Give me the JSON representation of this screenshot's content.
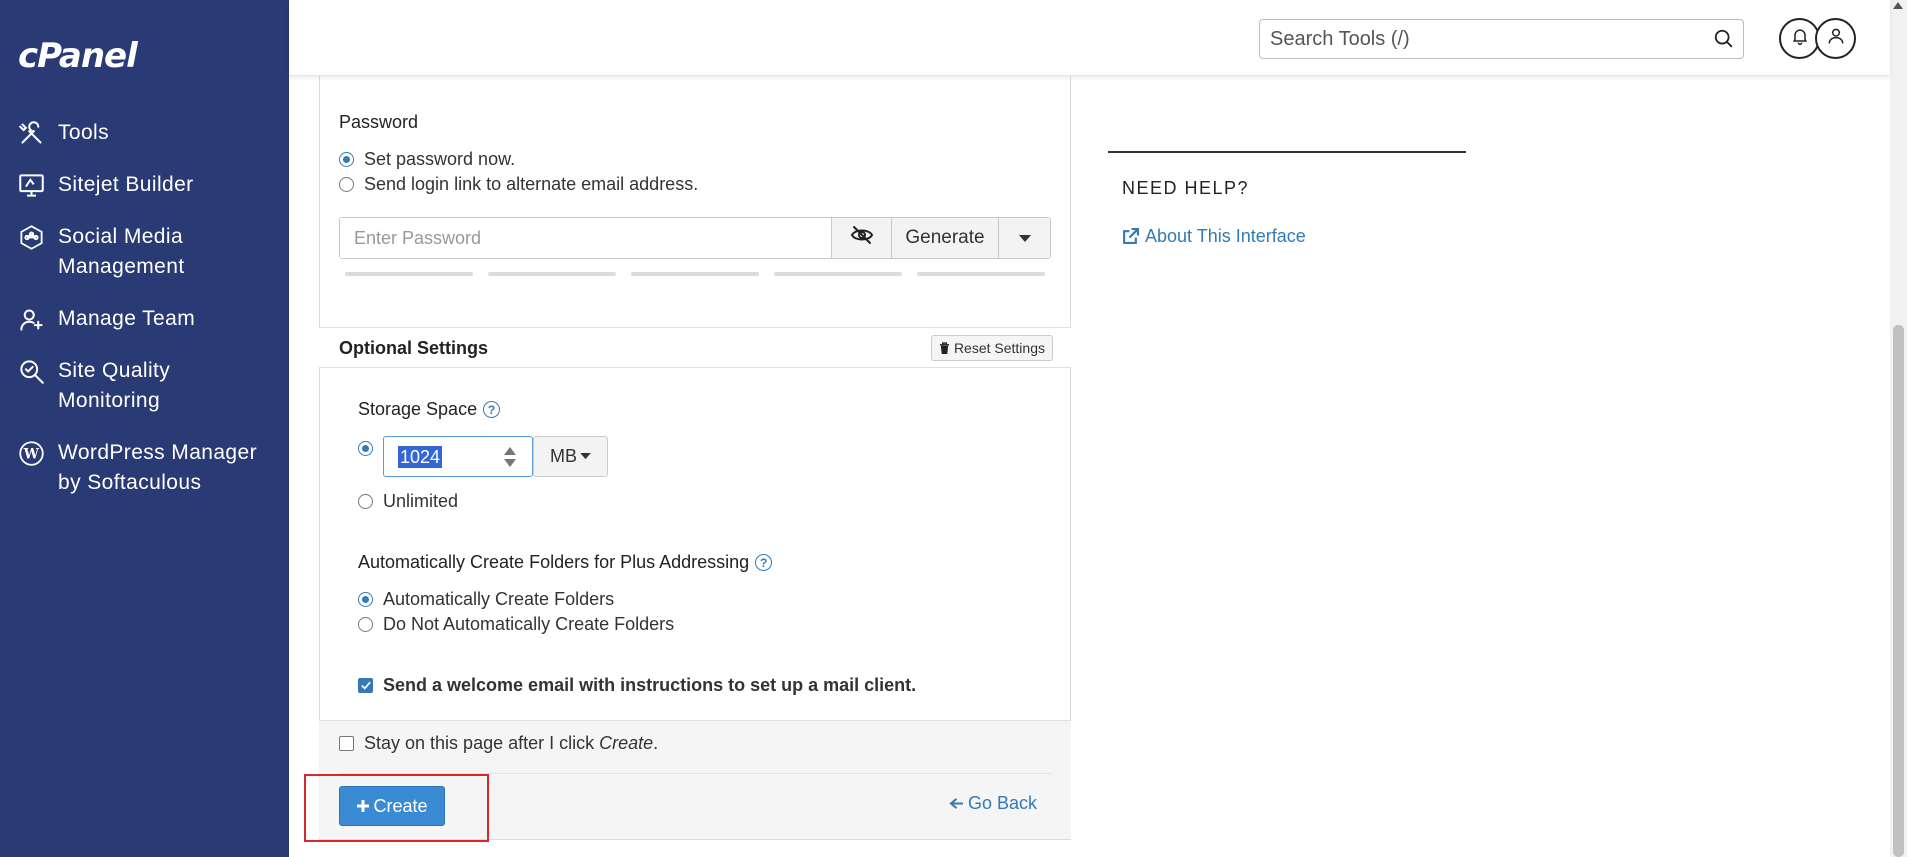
{
  "sidebar": {
    "logo": "cPanel",
    "items": [
      {
        "label": "Tools",
        "icon": "tools-icon"
      },
      {
        "label": "Sitejet Builder",
        "icon": "monitor-icon"
      },
      {
        "label": "Social Media Management",
        "icon": "social-icon"
      },
      {
        "label": "Manage Team",
        "icon": "team-icon"
      },
      {
        "label": "Site Quality Monitoring",
        "icon": "quality-icon"
      },
      {
        "label": "WordPress Manager by Softaculous",
        "icon": "wordpress-icon"
      }
    ]
  },
  "topbar": {
    "search_placeholder": "Search Tools (/)"
  },
  "password": {
    "title": "Password",
    "option_now": "Set password now.",
    "option_link": "Send login link to alternate email address.",
    "placeholder": "Enter Password",
    "generate_label": "Generate"
  },
  "optional": {
    "title": "Optional Settings",
    "reset_label": "Reset Settings",
    "storage_title": "Storage Space",
    "storage_value": "1024",
    "storage_unit": "MB",
    "unlimited_label": "Unlimited",
    "folders_title": "Automatically Create Folders for Plus Addressing",
    "folders_auto": "Automatically Create Folders",
    "folders_none": "Do Not Automatically Create Folders",
    "welcome_label": "Send a welcome email with instructions to set up a mail client."
  },
  "footer": {
    "stay_label": "Stay on this page after I click",
    "stay_em": "Create",
    "create_label": "Create",
    "goback_label": "Go Back"
  },
  "help": {
    "title": "NEED HELP?",
    "link": "About This Interface"
  },
  "colors": {
    "sidebar": "#293a74",
    "accent": "#337ab7",
    "create_button": "#3a8bd4",
    "highlight": "#d62a2a"
  }
}
